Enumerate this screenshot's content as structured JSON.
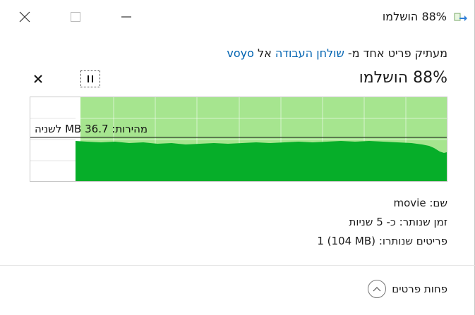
{
  "window": {
    "title": "88% הושלמו",
    "icon": "copy-arrow-icon"
  },
  "copy": {
    "prefix": "מעתיק פריט אחד מ-",
    "source": "שולחן העבודה",
    "middle": "אל",
    "destination": "voyo"
  },
  "progress": {
    "label": "88% הושלמו",
    "fraction": 0.88,
    "speed_label": "מהירות: 36.7 MB לשניה"
  },
  "details": {
    "name_label": "שם:",
    "name_value": "movie",
    "time_label": "זמן שנותר:",
    "time_value": "כ- 5 שניות",
    "items_label": "פריטים שנותרו:",
    "items_value": "1 (104 MB)"
  },
  "footer": {
    "fewer_details": "פחות פרטים"
  },
  "colors": {
    "progress_fill": "#a6e58f",
    "speed_fill": "#06ae29",
    "link": "#0063b1"
  }
}
